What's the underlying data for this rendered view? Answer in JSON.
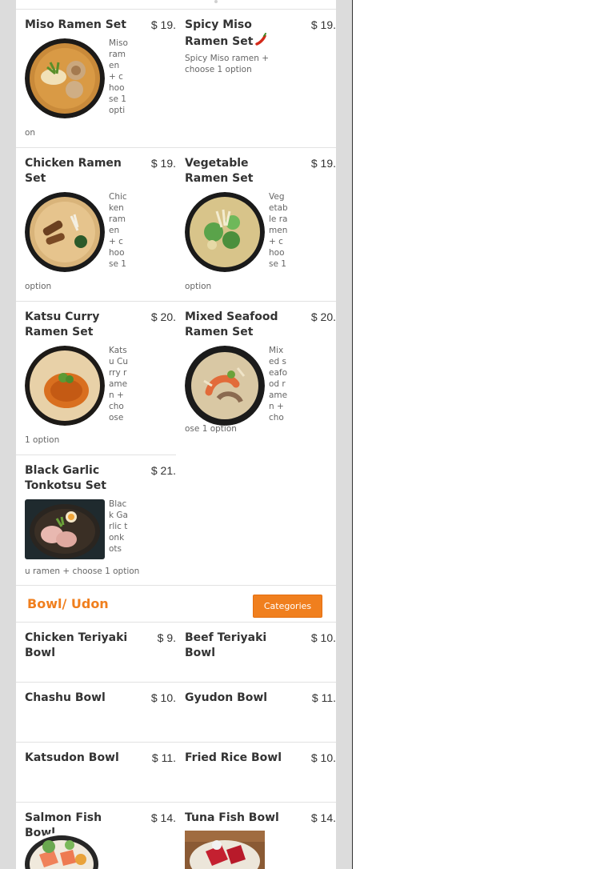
{
  "ramen_sets": [
    {
      "name": "Miso Ramen Set",
      "price": "$ 19.",
      "desc_narrow": "Miso ramen + choose 1 opti",
      "desc_tail": "on"
    },
    {
      "name": "Spicy Miso Ramen Set",
      "price": "$ 19.",
      "spicy_icon": "chili-pepper-icon",
      "desc": "Spicy Miso ramen + choose 1 option"
    },
    {
      "name": "Chicken Ramen Set",
      "price": "$ 19.",
      "desc_narrow": "Chicken ramen + choose 1",
      "desc_tail": "option"
    },
    {
      "name": "Vegetable Ramen Set",
      "price": "$ 19.",
      "desc_narrow": "Vegetable ramen + choose 1",
      "desc_tail": "option"
    },
    {
      "name": "Katsu Curry Ramen Set",
      "price": "$ 20.",
      "desc_narrow": "Katsu Curry ramen + choose",
      "desc_tail": "1 option"
    },
    {
      "name": "Mixed Seafood Ramen Set",
      "price": "$ 20.",
      "desc_narrow": "Mixed seafood ramen + cho",
      "desc_tail": "ose 1 option"
    },
    {
      "name": "Black Garlic Tonkotsu Set",
      "price": "$ 21.",
      "desc_narrow": "Black Garlic tonkots",
      "desc_tail": "u ramen + choose 1 option"
    }
  ],
  "section": {
    "title": "Bowl/ Udon",
    "categories_label": "Categories"
  },
  "bowls": [
    {
      "name": "Chicken Teriyaki Bowl",
      "price": "$ 9."
    },
    {
      "name": "Beef Teriyaki Bowl",
      "price": "$ 10."
    },
    {
      "name": "Chashu Bowl",
      "price": "$ 10."
    },
    {
      "name": "Gyudon Bowl",
      "price": "$ 11."
    },
    {
      "name": "Katsudon Bowl",
      "price": "$ 11."
    },
    {
      "name": "Fried Rice Bowl",
      "price": "$ 10."
    },
    {
      "name": "Salmon Fish Bowl",
      "price": "$ 14."
    },
    {
      "name": "Tuna Fish Bowl",
      "price": "$ 14."
    }
  ],
  "colors": {
    "accent": "#f07f1e",
    "text": "#333333",
    "muted": "#666666",
    "gutter": "#dcdcdc"
  }
}
